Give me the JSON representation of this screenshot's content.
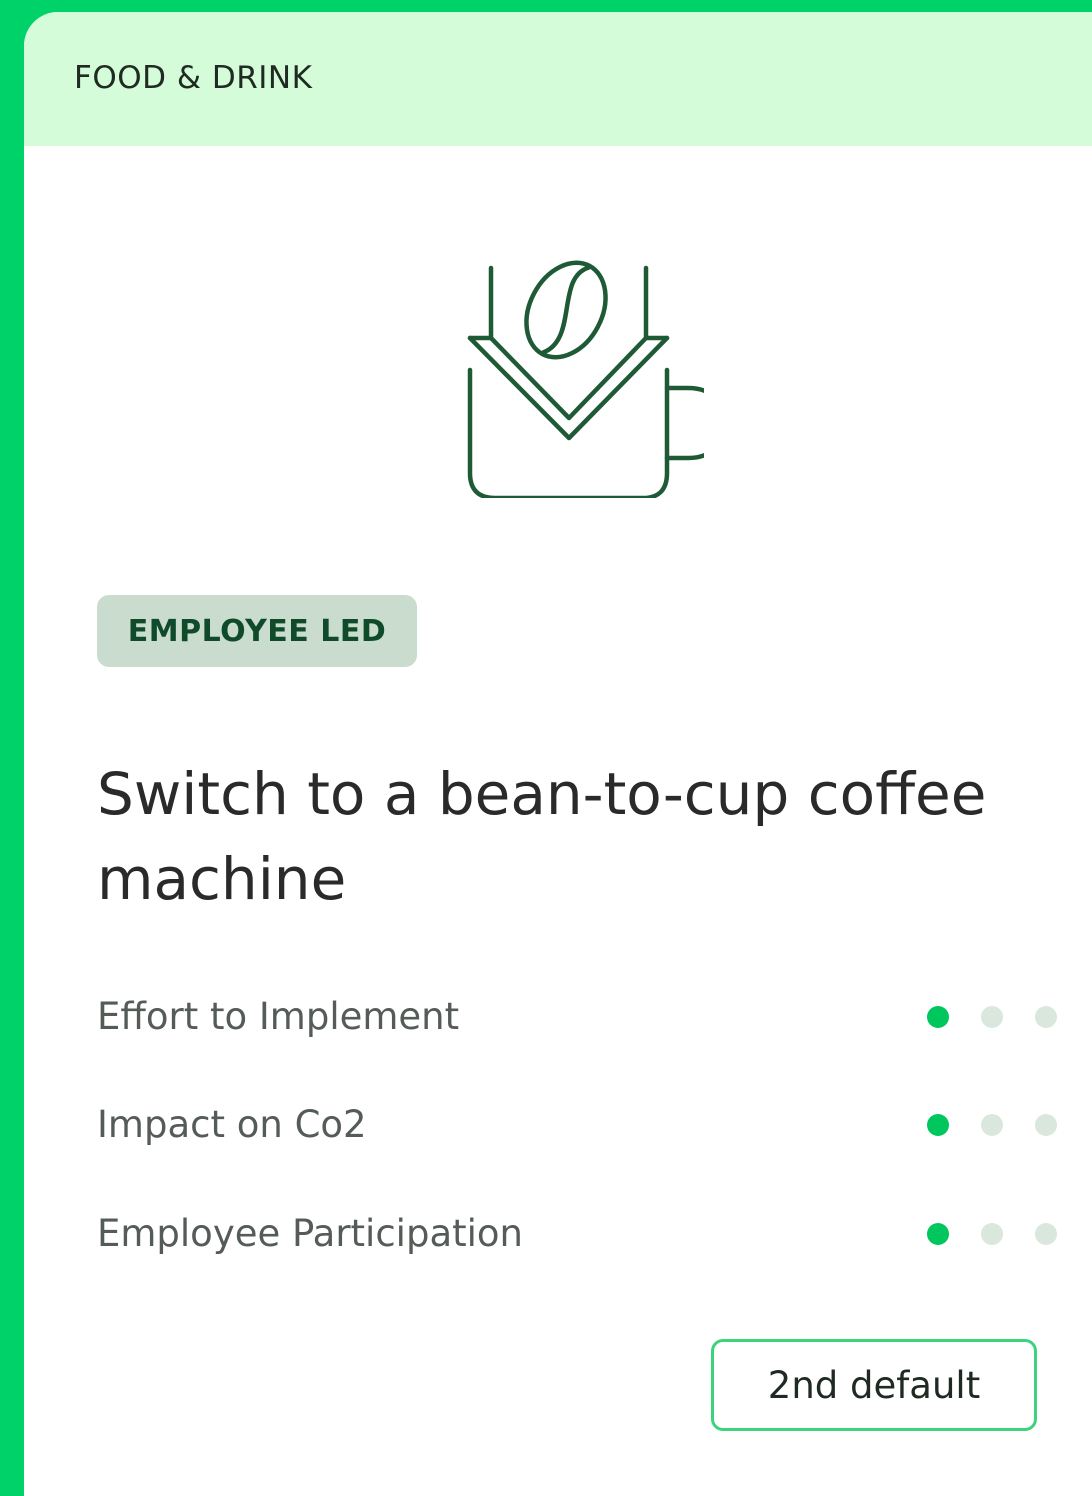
{
  "card": {
    "category": "FOOD & DRINK",
    "illustration_icon": "coffee-bean-into-cup-icon",
    "badge": "EMPLOYEE LED",
    "title": "Switch to a bean-to-cup coffee machine",
    "metrics": [
      {
        "label": "Effort to Implement",
        "rating": 1,
        "max": 3
      },
      {
        "label": "Impact on Co2",
        "rating": 1,
        "max": 3
      },
      {
        "label": "Employee Participation",
        "rating": 1,
        "max": 3
      }
    ],
    "button_label": "2nd default"
  },
  "colors": {
    "accent": "#00d26a",
    "header_bg": "#d4fcd9",
    "icon_stroke": "#1f5a36",
    "dot_active": "#00c65e",
    "dot_inactive": "#d9e7dd",
    "badge_bg": "#c9dccd",
    "badge_text": "#0f4a2a"
  }
}
